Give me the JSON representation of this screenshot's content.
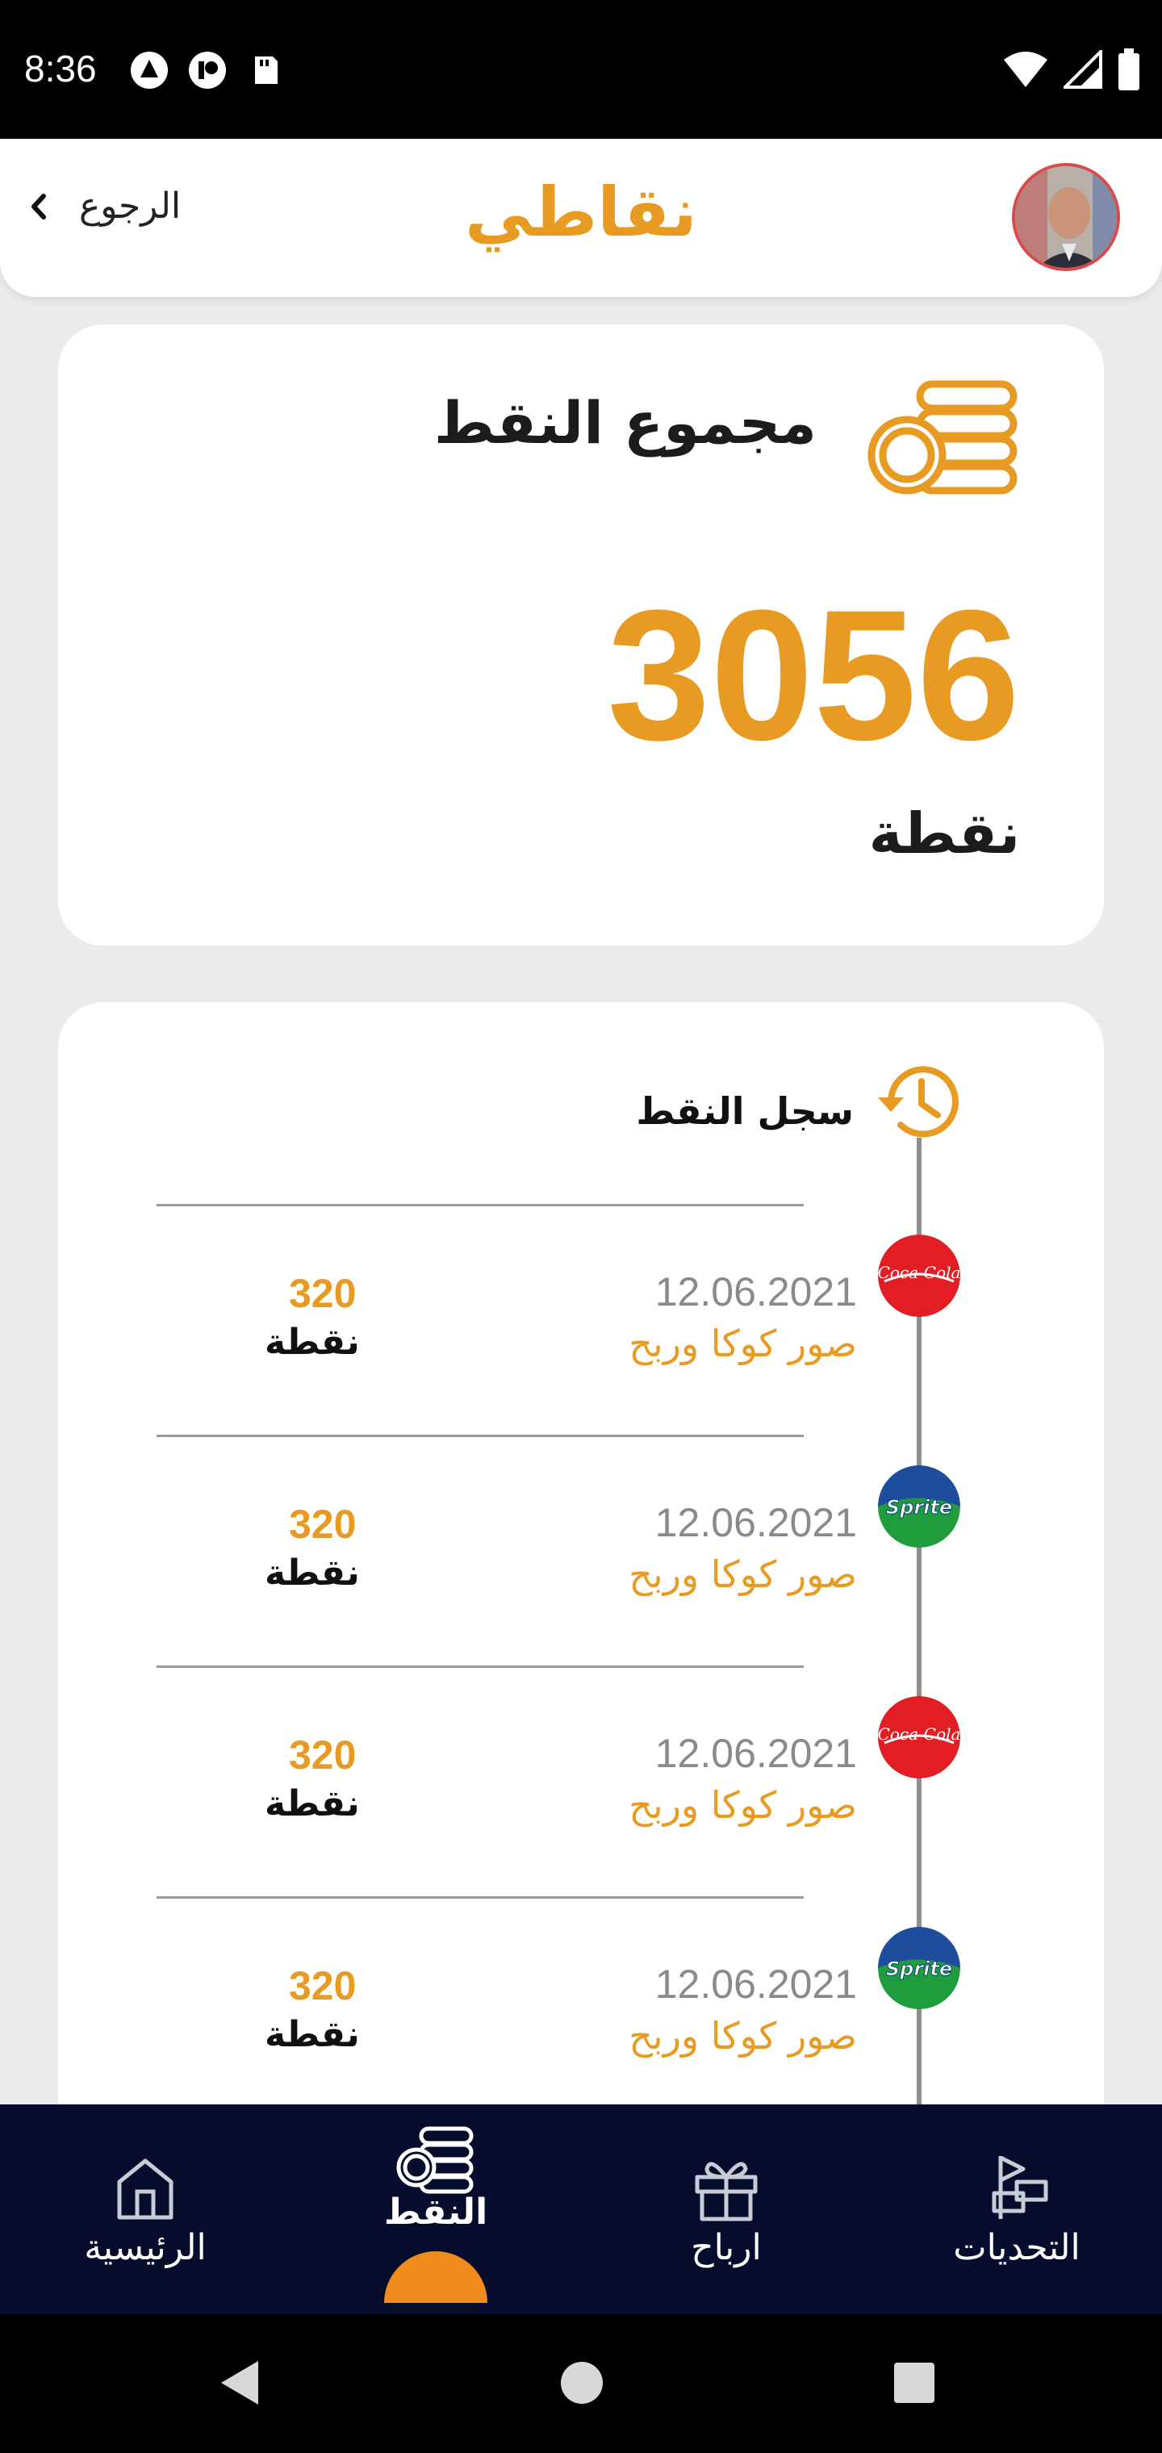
{
  "status_bar": {
    "time": "8:36",
    "left_icons": [
      "notification-icon",
      "app-notification-icon",
      "sd-card-icon"
    ],
    "right_icons": [
      "wifi-icon",
      "cellular-signal-icon",
      "battery-icon"
    ]
  },
  "header": {
    "back_label": "الرجوع",
    "title": "نقاطي",
    "avatar_icon": "user-avatar"
  },
  "total_card": {
    "label": "مجموع النقط",
    "value": "3056",
    "unit": "نقطة",
    "icon": "coins-icon"
  },
  "history": {
    "title": "سجل النقط",
    "icon": "history-icon",
    "entries": [
      {
        "date": "12.06.2021",
        "description": "صور كوكا وربح",
        "points": "320",
        "unit": "نقطة",
        "brand": "coca-cola"
      },
      {
        "date": "12.06.2021",
        "description": "صور كوكا وربح",
        "points": "320",
        "unit": "نقطة",
        "brand": "sprite"
      },
      {
        "date": "12.06.2021",
        "description": "صور كوكا وربح",
        "points": "320",
        "unit": "نقطة",
        "brand": "coca-cola"
      },
      {
        "date": "12.06.2021",
        "description": "صور كوكا وربح",
        "points": "320",
        "unit": "نقطة",
        "brand": "sprite"
      }
    ]
  },
  "bottom_nav": {
    "items": [
      {
        "label": "الرئيسية",
        "icon": "home-icon",
        "active": false
      },
      {
        "label": "النقط",
        "icon": "coins-icon",
        "active": true
      },
      {
        "label": "ارباح",
        "icon": "gift-icon",
        "active": false
      },
      {
        "label": "التحديات",
        "icon": "challenge-flag-icon",
        "active": false
      }
    ]
  },
  "colors": {
    "accent": "#e89b22",
    "nav_background": "#060c2b",
    "active_indicator": "#f08c1b",
    "page_background": "#ebebeb"
  }
}
